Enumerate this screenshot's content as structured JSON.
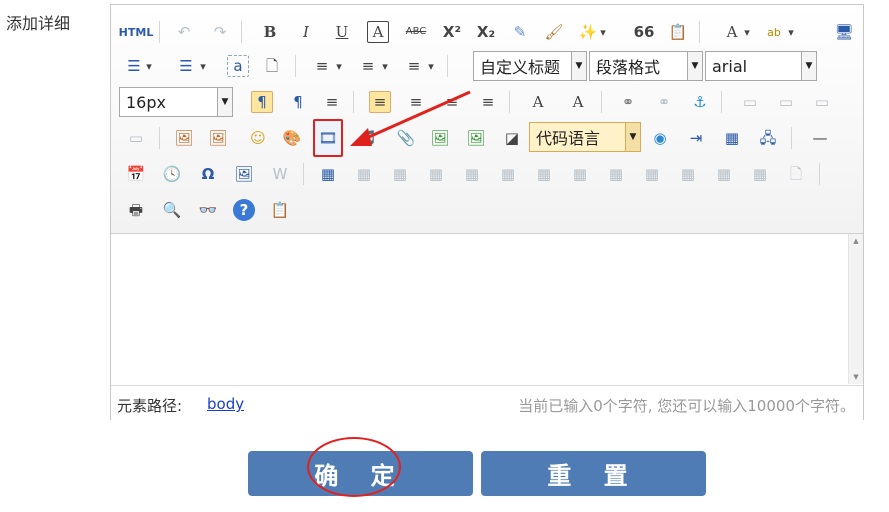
{
  "field_label": "添加详细",
  "toolbar": {
    "row1": [
      "HTML",
      "↶",
      "↷",
      "B",
      "I",
      "U",
      "A",
      "ABC",
      "X²",
      "X₂",
      "✎",
      "🖌",
      "✨",
      "66",
      "📋",
      "A",
      "ab",
      "🖥"
    ],
    "row2_icons": [
      "☰",
      "☰",
      "a",
      "🗋",
      "≡",
      "≡",
      "≡"
    ],
    "font_family_combo": "自定义标题",
    "paragraph_combo": "段落格式",
    "font_combo": "arial",
    "font_size_combo": "16px",
    "row3": [
      "¶",
      "¶",
      "≡",
      "≡",
      "≡",
      "≡",
      "≡",
      "A",
      "A",
      "⚭",
      "⚭",
      "⚓",
      "▭",
      "▭",
      "▭"
    ],
    "row4": [
      "▭",
      "🖼",
      "🖼",
      "☺",
      "🎨",
      "🎞",
      "🎵",
      "📎",
      "🖼",
      "🖼",
      "◪"
    ],
    "code_lang_combo": "代码语言",
    "row4b": [
      "◉",
      "⇥",
      "▦",
      "🖧",
      "—"
    ],
    "row5": [
      "📅",
      "🕓",
      "Ω",
      "🖼",
      "W",
      "▦",
      "▦",
      "▦",
      "▦",
      "▦",
      "▦",
      "▦",
      "▦",
      "▦",
      "▦",
      "▦",
      "▦",
      "▦",
      "🗋"
    ],
    "row6": [
      "🖶",
      "🔍",
      "👓",
      "?",
      "📋"
    ]
  },
  "statusbar": {
    "path_label": "元素路径:",
    "path_value": "body",
    "char_count": "当前已输入0个字符, 您还可以输入10000个字符。"
  },
  "buttons": {
    "confirm": "确 定",
    "reset": "重 置"
  },
  "colors": {
    "button_bg": "#4f7cb4",
    "annotation_red": "#e0221e",
    "active_bg": "#ffe69f"
  }
}
